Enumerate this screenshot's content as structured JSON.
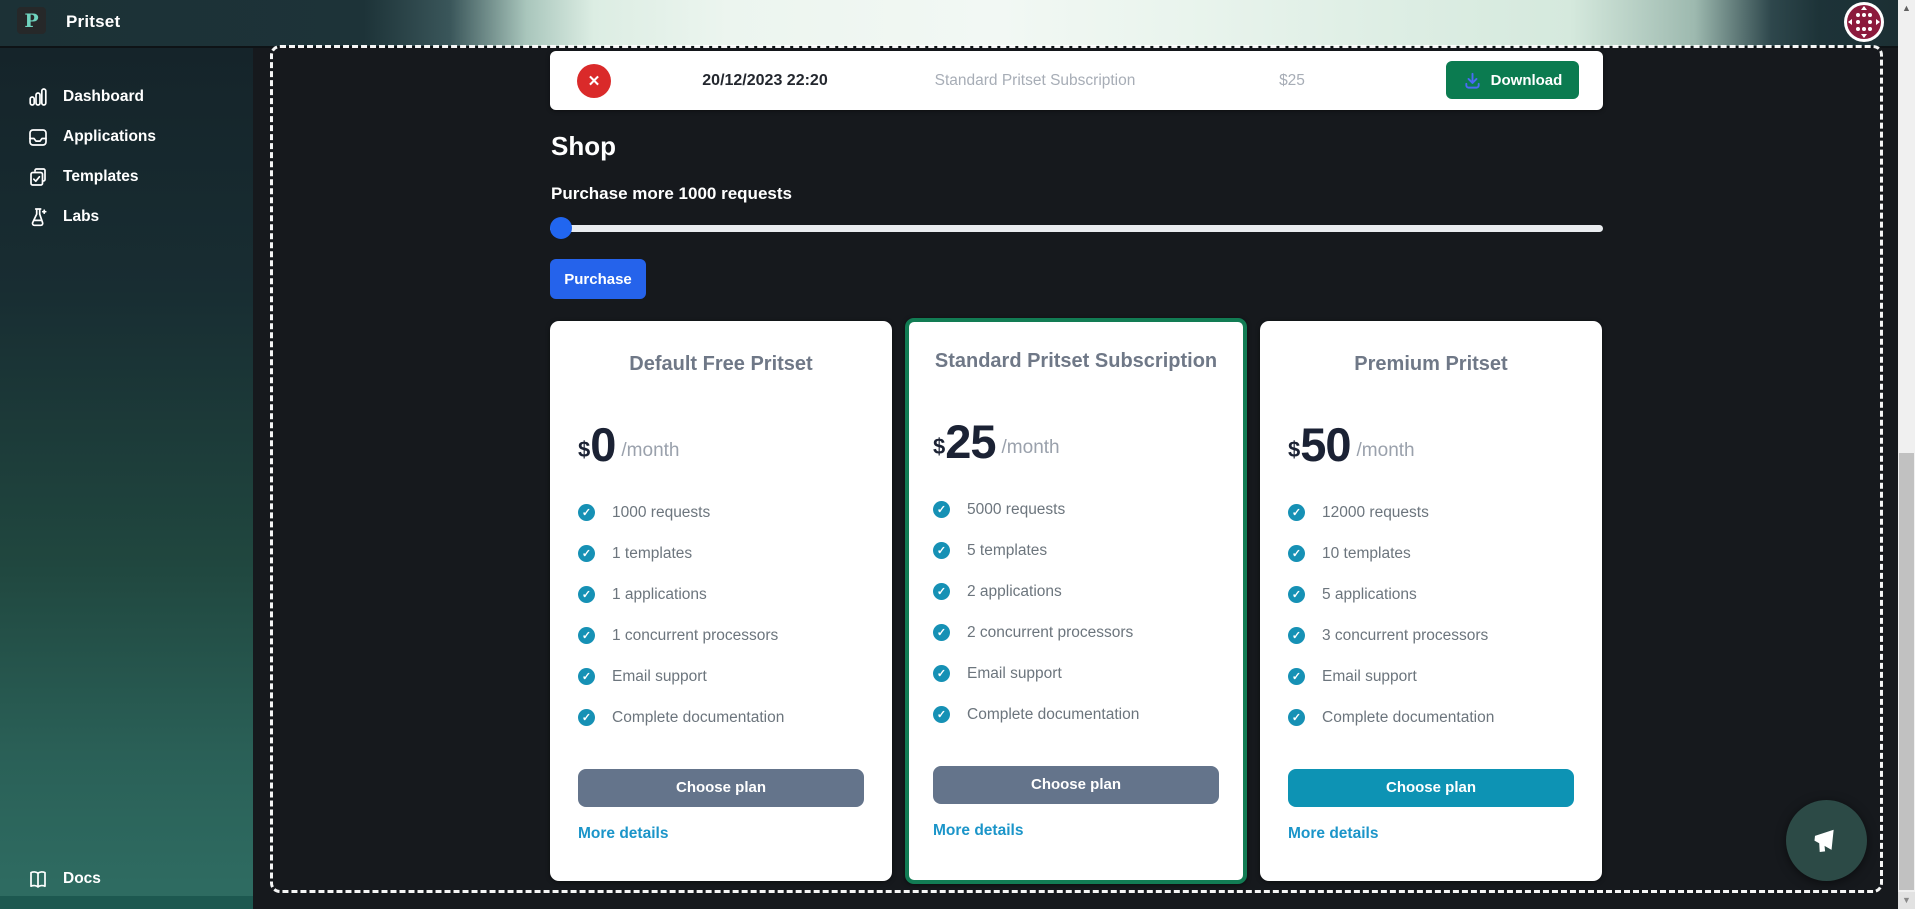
{
  "app": {
    "title": "Pritset",
    "logo_letter": "P"
  },
  "sidebar": {
    "items": [
      {
        "label": "Dashboard",
        "icon": "bar-chart-icon"
      },
      {
        "label": "Applications",
        "icon": "inbox-icon"
      },
      {
        "label": "Templates",
        "icon": "clipboard-check-icon"
      },
      {
        "label": "Labs",
        "icon": "flask-icon"
      }
    ],
    "footer": {
      "label": "Docs",
      "icon": "open-book-icon"
    }
  },
  "invoice_row": {
    "status_icon": "error-x-icon",
    "status_glyph": "✕",
    "date": "20/12/2023 22:20",
    "product": "Standard Pritset Subscription",
    "amount": "$25",
    "download_label": "Download",
    "download_icon": "download-icon"
  },
  "shop": {
    "heading": "Shop",
    "slider_label": "Purchase more 1000 requests",
    "slider_value_percent": 1,
    "purchase_label": "Purchase"
  },
  "plans": [
    {
      "title": "Default Free Pritset",
      "currency": "$",
      "price": "0",
      "period": "/month",
      "features": [
        "1000 requests",
        "1 templates",
        "1 applications",
        "1 concurrent processors",
        "Email support",
        "Complete documentation"
      ],
      "cta_label": "Choose plan",
      "link_label": "More details",
      "highlighted": false
    },
    {
      "title": "Standard Pritset Subscription",
      "currency": "$",
      "price": "25",
      "period": "/month",
      "features": [
        "5000 requests",
        "5 templates",
        "2 applications",
        "2 concurrent processors",
        "Email support",
        "Complete documentation"
      ],
      "cta_label": "Choose plan",
      "link_label": "More details",
      "highlighted": true
    },
    {
      "title": "Premium Pritset",
      "currency": "$",
      "price": "50",
      "period": "/month",
      "features": [
        "12000 requests",
        "10 templates",
        "5 applications",
        "3 concurrent processors",
        "Email support",
        "Complete documentation"
      ],
      "cta_label": "Choose plan",
      "link_label": "More details",
      "highlighted": false
    }
  ],
  "check_glyph": "✓",
  "floating_button": {
    "icon": "megaphone-icon"
  },
  "scrollbar": {
    "up_glyph": "▲",
    "down_glyph": "▼"
  },
  "colors": {
    "page_bg": "#16191d",
    "header_mint": "#eef6f1",
    "sidebar_teal": "#2e6b61",
    "error_red": "#da2a2a",
    "download_green": "#0b7b50",
    "highlight_green": "#127c54",
    "primary_blue": "#2563eb",
    "slate_button": "#64748b",
    "teal_button": "#0d93b4",
    "check_teal": "#1691b5",
    "link_blue": "#1b95c9"
  }
}
